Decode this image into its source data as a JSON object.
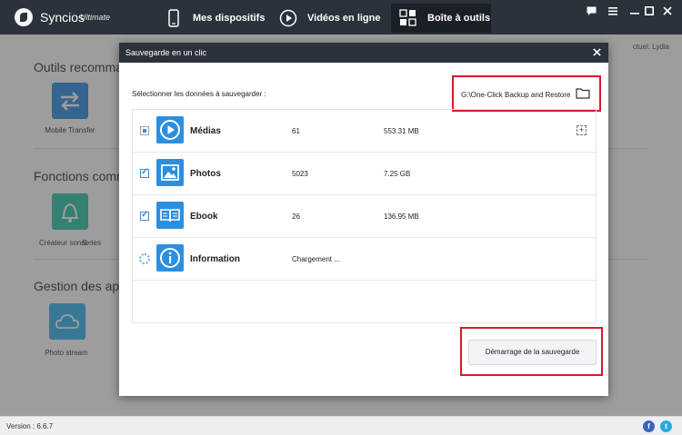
{
  "app": {
    "name": "Syncios",
    "edition": "Ultimate",
    "version_label": "Version : 6.6.7"
  },
  "tabs": [
    {
      "label": "Mes dispositifs",
      "icon": "phone-icon"
    },
    {
      "label": "Vidéos en ligne",
      "icon": "play-circle-icon"
    },
    {
      "label": "Boîte à outils",
      "icon": "grid-icon"
    }
  ],
  "window_controls": [
    "chat-icon",
    "menu-icon",
    "minimize-icon",
    "maximize-icon",
    "close-icon"
  ],
  "background": {
    "user_label": "ctuel: Lydia",
    "sections": [
      {
        "title": "Outils recommar"
      },
      {
        "title": "Fonctions comm"
      },
      {
        "title": "Gestion des app"
      }
    ],
    "tools": [
      {
        "label": "Mobile Transfer",
        "icon": "transfer-arrows-icon",
        "color": "#2b8fe0"
      },
      {
        "label": "Créateur sonneries",
        "icon": "bell-icon",
        "color": "#2ec4a5"
      },
      {
        "label": "Photo stream",
        "icon": "cloud-icon",
        "color": "#35b5f0"
      }
    ],
    "partial_label": "S"
  },
  "dialog": {
    "title": "Sauvegarde en un clic",
    "select_label": "Sélectionner les données à sauvegarder :",
    "path": "G:\\One-Click Backup and Restore",
    "rows": [
      {
        "name": "Médias",
        "count": "61",
        "size": "553.31 MB",
        "state": "partial",
        "icon": "play-icon"
      },
      {
        "name": "Photos",
        "count": "5023",
        "size": "7.25 GB",
        "state": "checked",
        "icon": "image-icon"
      },
      {
        "name": "Ebook",
        "count": "26",
        "size": "136.95 MB",
        "state": "checked",
        "icon": "book-icon"
      },
      {
        "name": "Information",
        "count": "Chargement ...",
        "size": "",
        "state": "loading",
        "icon": "info-icon"
      }
    ],
    "expand_symbol": "+",
    "start_button": "Démarrage de la sauvegarde"
  },
  "colors": {
    "titlebar": "#2c323b",
    "accent": "#2b8fe0",
    "highlight": "#d8182a"
  }
}
